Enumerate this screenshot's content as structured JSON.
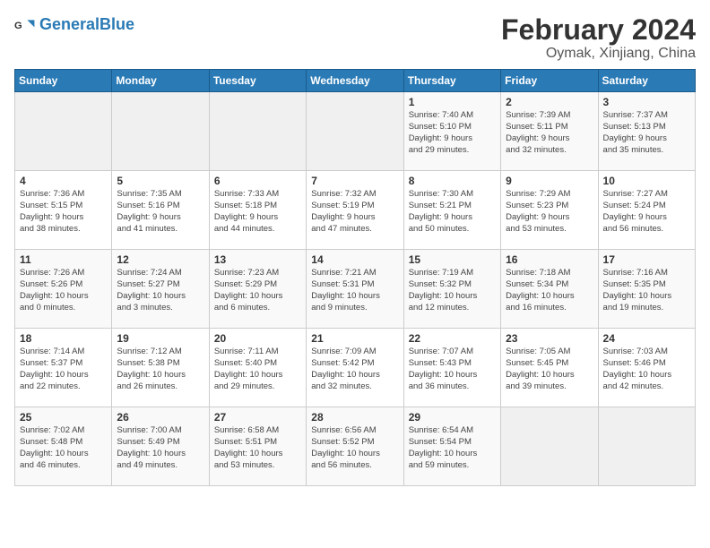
{
  "logo": {
    "text_general": "General",
    "text_blue": "Blue"
  },
  "title": "February 2024",
  "subtitle": "Oymak, Xinjiang, China",
  "days_of_week": [
    "Sunday",
    "Monday",
    "Tuesday",
    "Wednesday",
    "Thursday",
    "Friday",
    "Saturday"
  ],
  "weeks": [
    [
      {
        "day": "",
        "info": ""
      },
      {
        "day": "",
        "info": ""
      },
      {
        "day": "",
        "info": ""
      },
      {
        "day": "",
        "info": ""
      },
      {
        "day": "1",
        "info": "Sunrise: 7:40 AM\nSunset: 5:10 PM\nDaylight: 9 hours\nand 29 minutes."
      },
      {
        "day": "2",
        "info": "Sunrise: 7:39 AM\nSunset: 5:11 PM\nDaylight: 9 hours\nand 32 minutes."
      },
      {
        "day": "3",
        "info": "Sunrise: 7:37 AM\nSunset: 5:13 PM\nDaylight: 9 hours\nand 35 minutes."
      }
    ],
    [
      {
        "day": "4",
        "info": "Sunrise: 7:36 AM\nSunset: 5:15 PM\nDaylight: 9 hours\nand 38 minutes."
      },
      {
        "day": "5",
        "info": "Sunrise: 7:35 AM\nSunset: 5:16 PM\nDaylight: 9 hours\nand 41 minutes."
      },
      {
        "day": "6",
        "info": "Sunrise: 7:33 AM\nSunset: 5:18 PM\nDaylight: 9 hours\nand 44 minutes."
      },
      {
        "day": "7",
        "info": "Sunrise: 7:32 AM\nSunset: 5:19 PM\nDaylight: 9 hours\nand 47 minutes."
      },
      {
        "day": "8",
        "info": "Sunrise: 7:30 AM\nSunset: 5:21 PM\nDaylight: 9 hours\nand 50 minutes."
      },
      {
        "day": "9",
        "info": "Sunrise: 7:29 AM\nSunset: 5:23 PM\nDaylight: 9 hours\nand 53 minutes."
      },
      {
        "day": "10",
        "info": "Sunrise: 7:27 AM\nSunset: 5:24 PM\nDaylight: 9 hours\nand 56 minutes."
      }
    ],
    [
      {
        "day": "11",
        "info": "Sunrise: 7:26 AM\nSunset: 5:26 PM\nDaylight: 10 hours\nand 0 minutes."
      },
      {
        "day": "12",
        "info": "Sunrise: 7:24 AM\nSunset: 5:27 PM\nDaylight: 10 hours\nand 3 minutes."
      },
      {
        "day": "13",
        "info": "Sunrise: 7:23 AM\nSunset: 5:29 PM\nDaylight: 10 hours\nand 6 minutes."
      },
      {
        "day": "14",
        "info": "Sunrise: 7:21 AM\nSunset: 5:31 PM\nDaylight: 10 hours\nand 9 minutes."
      },
      {
        "day": "15",
        "info": "Sunrise: 7:19 AM\nSunset: 5:32 PM\nDaylight: 10 hours\nand 12 minutes."
      },
      {
        "day": "16",
        "info": "Sunrise: 7:18 AM\nSunset: 5:34 PM\nDaylight: 10 hours\nand 16 minutes."
      },
      {
        "day": "17",
        "info": "Sunrise: 7:16 AM\nSunset: 5:35 PM\nDaylight: 10 hours\nand 19 minutes."
      }
    ],
    [
      {
        "day": "18",
        "info": "Sunrise: 7:14 AM\nSunset: 5:37 PM\nDaylight: 10 hours\nand 22 minutes."
      },
      {
        "day": "19",
        "info": "Sunrise: 7:12 AM\nSunset: 5:38 PM\nDaylight: 10 hours\nand 26 minutes."
      },
      {
        "day": "20",
        "info": "Sunrise: 7:11 AM\nSunset: 5:40 PM\nDaylight: 10 hours\nand 29 minutes."
      },
      {
        "day": "21",
        "info": "Sunrise: 7:09 AM\nSunset: 5:42 PM\nDaylight: 10 hours\nand 32 minutes."
      },
      {
        "day": "22",
        "info": "Sunrise: 7:07 AM\nSunset: 5:43 PM\nDaylight: 10 hours\nand 36 minutes."
      },
      {
        "day": "23",
        "info": "Sunrise: 7:05 AM\nSunset: 5:45 PM\nDaylight: 10 hours\nand 39 minutes."
      },
      {
        "day": "24",
        "info": "Sunrise: 7:03 AM\nSunset: 5:46 PM\nDaylight: 10 hours\nand 42 minutes."
      }
    ],
    [
      {
        "day": "25",
        "info": "Sunrise: 7:02 AM\nSunset: 5:48 PM\nDaylight: 10 hours\nand 46 minutes."
      },
      {
        "day": "26",
        "info": "Sunrise: 7:00 AM\nSunset: 5:49 PM\nDaylight: 10 hours\nand 49 minutes."
      },
      {
        "day": "27",
        "info": "Sunrise: 6:58 AM\nSunset: 5:51 PM\nDaylight: 10 hours\nand 53 minutes."
      },
      {
        "day": "28",
        "info": "Sunrise: 6:56 AM\nSunset: 5:52 PM\nDaylight: 10 hours\nand 56 minutes."
      },
      {
        "day": "29",
        "info": "Sunrise: 6:54 AM\nSunset: 5:54 PM\nDaylight: 10 hours\nand 59 minutes."
      },
      {
        "day": "",
        "info": ""
      },
      {
        "day": "",
        "info": ""
      }
    ]
  ],
  "labels": {
    "sunrise_prefix": "Sunrise: ",
    "sunset_prefix": "Sunset: ",
    "daylight_prefix": "Daylight hours"
  }
}
